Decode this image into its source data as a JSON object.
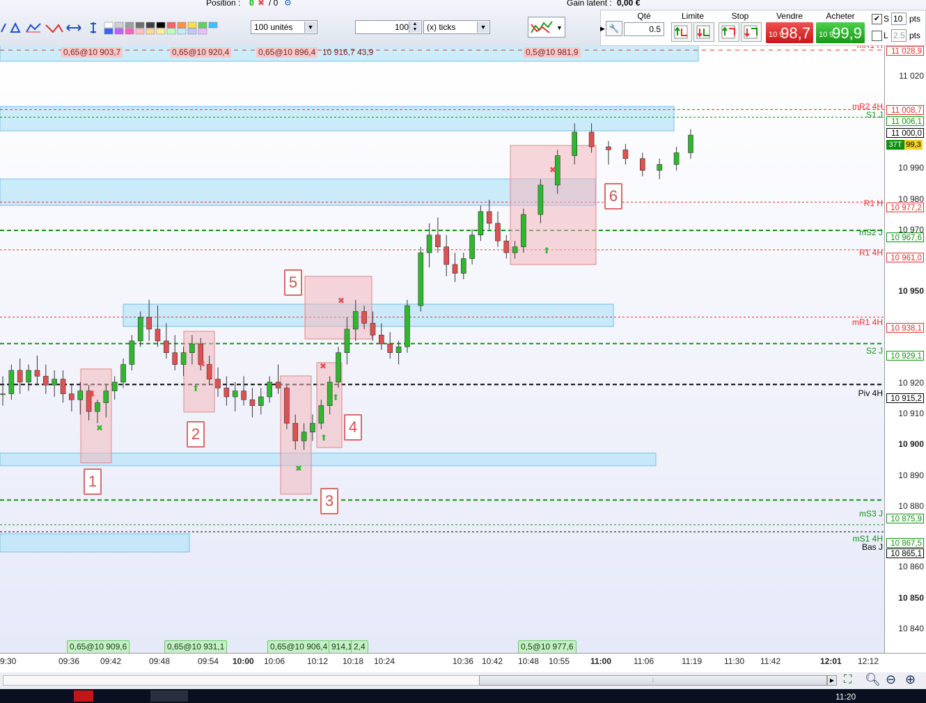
{
  "toolbar": {
    "position_label": "Position :",
    "position_value": "0",
    "position_sep": "/ 0",
    "gain_label": "Gain latent :",
    "gain_value": "0,00 €",
    "qty_combo": "100 unités",
    "ticks_value": "100",
    "ticks_unit": "(x) ticks",
    "qte_header": "Qté",
    "qte_value": "0.5",
    "limite_header": "Limite",
    "stop_header": "Stop",
    "vendre_header": "Vendre",
    "acheter_header": "Acheter",
    "sell_small": "10 9",
    "sell_big": "98,7",
    "buy_small": "10 9",
    "buy_big": "99,9",
    "s_label": "S",
    "s_value": "10",
    "l_label": "L",
    "l_value": "2.5",
    "pts1": "pts",
    "pts2": "pts"
  },
  "colors": {
    "bull": "#2eb82e",
    "bear": "#e05050",
    "zone_blue": "#b8e4f8",
    "zone_red": "#f2b8be",
    "resistance": "#e03030",
    "support": "#109010"
  },
  "price_axis": {
    "ticks": [
      "11 020",
      "10 990",
      "10 980",
      "10 970",
      "10 950",
      "10 920",
      "10 910",
      "10 900",
      "10 890",
      "10 880",
      "10 860",
      "10 850",
      "10 840"
    ],
    "boxes": [
      {
        "value": "11 028,9",
        "color": "#e03030"
      },
      {
        "value": "11 008,7",
        "color": "#e03030"
      },
      {
        "value": "11 006,1",
        "color": "#109010"
      },
      {
        "value": "11 000,0",
        "color": "#000000"
      },
      {
        "value": "10 977,2",
        "color": "#e03030"
      },
      {
        "value": "10 967,6",
        "color": "#109010"
      },
      {
        "value": "10 961,0",
        "color": "#e03030"
      },
      {
        "value": "10 938,1",
        "color": "#e03030"
      },
      {
        "value": "10 929,1",
        "color": "#109010"
      },
      {
        "value": "10 915,2",
        "color": "#000000"
      },
      {
        "value": "10 875,9",
        "color": "#109010"
      },
      {
        "value": "10 867,5",
        "color": "#109010"
      },
      {
        "value": "10 865,1",
        "color": "#000000"
      }
    ],
    "tick_count": "37T",
    "last_price": "99,3"
  },
  "levels": [
    "mR2 4H",
    "S1 J",
    "R1 H",
    "mS2 J",
    "R1 4H",
    "mR1 4H",
    "S2 J",
    "Piv 4H",
    "mS3 J",
    "mS1 4H",
    "Bas J"
  ],
  "order_tags_top": [
    "0,65@10 903,7",
    "0,65@10 920,4",
    "0,65@10 896,4",
    "10 916,7",
    "43,9",
    "0,5@10 981,9"
  ],
  "order_tags_bottom": [
    "0,65@10 909,6",
    "0,65@10 931,1",
    "0,65@10 906,4",
    "914,1",
    "2,4",
    "0,5@10 977,6"
  ],
  "trade_numbers": [
    "1",
    "2",
    "3",
    "4",
    "5",
    "6"
  ],
  "time_axis": [
    "9:30",
    "09:36",
    "09:42",
    "09:48",
    "09:54",
    "10:00",
    "10:06",
    "10:12",
    "10:18",
    "10:24",
    "10:36",
    "10:42",
    "10:48",
    "10:55",
    "11:00",
    "11:06",
    "11:19",
    "11:30",
    "11:42",
    "12:01",
    "12:12"
  ],
  "taskbar_time": "11:20",
  "chart_data": {
    "type": "candlestick",
    "unit": "points",
    "candles": [
      [
        10912,
        10918,
        10908,
        10912
      ],
      [
        10912,
        10922,
        10910,
        10920
      ],
      [
        10920,
        10924,
        10912,
        10916
      ],
      [
        10916,
        10922,
        10913,
        10920
      ],
      [
        10920,
        10925,
        10915,
        10918
      ],
      [
        10918,
        10922,
        10912,
        10915
      ],
      [
        10915,
        10920,
        10911,
        10917
      ],
      [
        10917,
        10920,
        10909,
        10912
      ],
      [
        10912,
        10915,
        10906,
        10910
      ],
      [
        10910,
        10916,
        10905,
        10913
      ],
      [
        10913,
        10915,
        10903,
        10906
      ],
      [
        10906,
        10910,
        10902,
        10909
      ],
      [
        10909,
        10915,
        10904,
        10913
      ],
      [
        10913,
        10918,
        10910,
        10916
      ],
      [
        10916,
        10924,
        10914,
        10922
      ],
      [
        10922,
        10932,
        10920,
        10930
      ],
      [
        10930,
        10940,
        10928,
        10938
      ],
      [
        10938,
        10944,
        10930,
        10934
      ],
      [
        10934,
        10942,
        10928,
        10930
      ],
      [
        10930,
        10936,
        10924,
        10926
      ],
      [
        10926,
        10932,
        10920,
        10922
      ],
      [
        10922,
        10928,
        10918,
        10926
      ],
      [
        10926,
        10932,
        10922,
        10929
      ],
      [
        10929,
        10931,
        10920,
        10922
      ],
      [
        10922,
        10925,
        10915,
        10917
      ],
      [
        10917,
        10921,
        10911,
        10914
      ],
      [
        10914,
        10918,
        10908,
        10911
      ],
      [
        10911,
        10916,
        10906,
        10913
      ],
      [
        10913,
        10918,
        10908,
        10910
      ],
      [
        10910,
        10914,
        10904,
        10908
      ],
      [
        10908,
        10914,
        10905,
        10911
      ],
      [
        10911,
        10918,
        10909,
        10916
      ],
      [
        10916,
        10922,
        10912,
        10914
      ],
      [
        10914,
        10915,
        10900,
        10902
      ],
      [
        10902,
        10905,
        10893,
        10896
      ],
      [
        10896,
        10902,
        10893,
        10899
      ],
      [
        10899,
        10905,
        10896,
        10902
      ],
      [
        10902,
        10910,
        10900,
        10908
      ],
      [
        10908,
        10918,
        10905,
        10916
      ],
      [
        10916,
        10928,
        10914,
        10926
      ],
      [
        10926,
        10938,
        10922,
        10934
      ],
      [
        10934,
        10944,
        10930,
        10940
      ],
      [
        10940,
        10942,
        10934,
        10936
      ],
      [
        10936,
        10940,
        10930,
        10932
      ],
      [
        10932,
        10936,
        10927,
        10929
      ],
      [
        10929,
        10933,
        10924,
        10926
      ],
      [
        10926,
        10930,
        10922,
        10928
      ],
      [
        10928,
        10944,
        10926,
        10942
      ],
      [
        10942,
        10962,
        10940,
        10960
      ],
      [
        10960,
        10970,
        10955,
        10966
      ],
      [
        10966,
        10972,
        10960,
        10962
      ],
      [
        10962,
        10966,
        10952,
        10956
      ],
      [
        10956,
        10960,
        10950,
        10953
      ],
      [
        10953,
        10960,
        10951,
        10958
      ],
      [
        10958,
        10968,
        10956,
        10966
      ],
      [
        10966,
        10976,
        10964,
        10974
      ],
      [
        10974,
        10978,
        10968,
        10970
      ],
      [
        10970,
        10974,
        10962,
        10964
      ],
      [
        10964,
        10966,
        10958,
        10960
      ],
      [
        10960,
        10964,
        10958,
        10962
      ],
      [
        10962,
        10975,
        10960,
        10973
      ],
      [
        10973,
        10985,
        10970,
        10983
      ],
      [
        10983,
        10995,
        10980,
        10993
      ],
      [
        10993,
        11004,
        10990,
        11001
      ],
      [
        11001,
        11004,
        10994,
        10996
      ],
      [
        10996,
        10998,
        10990,
        10995
      ],
      [
        10995,
        10997,
        10990,
        10992
      ],
      [
        10992,
        10994,
        10986,
        10988
      ],
      [
        10988,
        10992,
        10985,
        10990
      ],
      [
        10990,
        10996,
        10988,
        10994
      ],
      [
        10994,
        11002,
        10992,
        11000
      ]
    ]
  }
}
